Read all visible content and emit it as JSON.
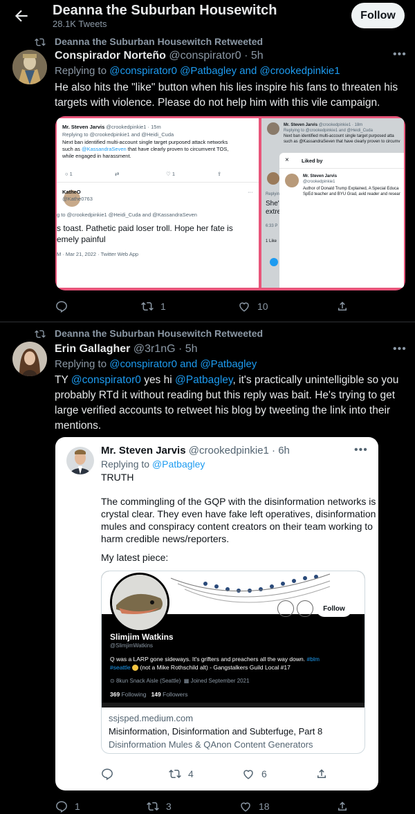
{
  "header": {
    "title": "Deanna the Suburban Housewitch",
    "tweet_count": "28.1K Tweets",
    "follow_label": "Follow"
  },
  "tweet1": {
    "retweeted_by": "Deanna the Suburban Housewitch Retweeted",
    "name": "Conspirador Norteño",
    "handle_time": "@conspirator0 · 5h",
    "replying_prefix": "Replying to",
    "replying_to": "@conspirator0 @Patbagley and @crookedpinkie1",
    "text_line1": "He also hits the \"like\" button when his lies inspire his fans to threaten his",
    "text_line2": "targets with violence. Please do not help him with this vile campaign.",
    "image": {
      "left": {
        "name": "Mr. Steven Jarvis",
        "handle_time": "@crookedpinkie1 · 15m",
        "replying": "Replying to @crookedpinkie1 and @Heidi_Cuda",
        "body1": "Next ban identified multi-account single target purposed attack networks",
        "body2_prefix": "such as",
        "body2_mention": "@KassandraSeven",
        "body2_suffix": "that have clearly proven to circumvent TOS,",
        "body3": "while engaged in harassment.",
        "reply_count": "1",
        "like_count": "1",
        "reply_author": "KatheO",
        "reply_handle": "@Kathe0763",
        "reply_replying": "g to @crookedpinkie1 @Heidi_Cuda and @KassandraSeven",
        "reply_text1": "s toast. Pathetic paid loser troll. Hope her fate is",
        "reply_text2": "emely painful",
        "reply_meta": "M · Mar 21, 2022 · Twitter Web App"
      },
      "right": {
        "name": "Mr. Steven Jarvis",
        "handle_time": "@crookedpinkie1 · 18m",
        "replying": "Replying to @crookedpinkie1 and @Heidi_Cuda",
        "body1": "Next ban identified multi-account single target purposed atta",
        "body2": "such as @KassandraSeven that have clearly proven to circumv",
        "liked_by_title": "Liked by",
        "liked_name": "Mr. Steven Jarvis",
        "liked_handle": "@crookedpinkie1",
        "liked_bio1": "Author of Donald Trump Explained, A Special Educa",
        "liked_bio2": "SpEd teacher and BYU Grad, avid reader and resear",
        "side1": "Replyin",
        "side2": "She's",
        "side3": "extre",
        "side4": "6:33 P",
        "side5": "1 Like"
      }
    },
    "actions": {
      "reply": "",
      "retweet": "1",
      "like": "10"
    }
  },
  "tweet2": {
    "retweeted_by": "Deanna the Suburban Housewitch Retweeted",
    "name": "Erin Gallagher",
    "handle_time": "@3r1nG · 5h",
    "replying_prefix": "Replying to",
    "replying_to": "@conspirator0 and @Patbagley",
    "text_line1_prefix": "TY",
    "text_line1_mention1": "@conspirator0",
    "text_line1_mid": "yes hi",
    "text_line1_mention2": "@Patbagley",
    "text_line1_suffix": ", it's practically unintelligible so you",
    "text_line2": "probably RTd it without reading but this reply was bait. He's trying to get",
    "text_line3": "large verified accounts to retweet his blog by tweeting the link into their",
    "text_line4": "mentions.",
    "quoted": {
      "name": "Mr. Steven Jarvis",
      "handle_time": "@crookedpinkie1 · 6h",
      "replying_prefix": "Replying to",
      "replying_to": "@Patbagley",
      "truth": "TRUTH",
      "p1": "The commingling of the GQP with the disinformation networks is",
      "p2": "crystal clear. They even have fake left operatives, disinformation",
      "p3": "mules and conspiracy content creators on their team working to",
      "p4": "harm credible news/reporters.",
      "p5": "My latest piece:",
      "card": {
        "profile_name": "Slimjim Watkins",
        "profile_handle": "@SlimjimWatkins",
        "follow_label": "Follow",
        "bio1_prefix": "Q was a LARP gone sideways. It's grifters and preachers all the way down.",
        "bio1_tag": "#blm",
        "bio2_tag": "#seattle",
        "bio2_suffix": "(not a Mike Rothschild alt) - Gangstalkers Guild Local #17",
        "location": "8kun Snack Aisle (Seattle)",
        "joined": "Joined September 2021",
        "following_count": "369",
        "following_label": "Following",
        "followers_count": "149",
        "followers_label": "Followers",
        "domain": "ssjsped.medium.com",
        "headline": "Misinformation, Disinformation and Subterfuge, Part 8",
        "description": "Disinformation Mules & QAnon Content Generators"
      },
      "actions": {
        "reply": "",
        "retweet": "4",
        "like": "6"
      }
    },
    "actions": {
      "reply": "1",
      "retweet": "3",
      "like": "18"
    }
  }
}
